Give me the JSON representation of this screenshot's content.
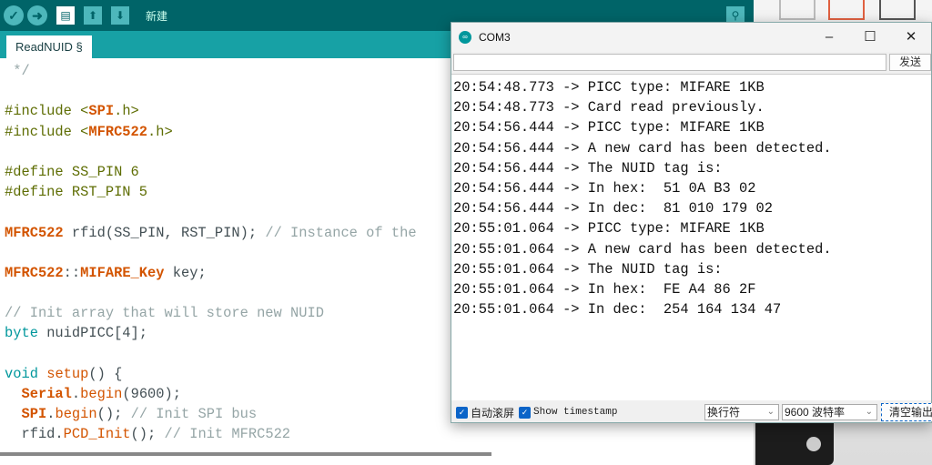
{
  "toolbar": {
    "new_label": "新建"
  },
  "editor": {
    "tab_label": "ReadNUID §",
    "lines": [
      [
        [
          " */",
          "cm"
        ]
      ],
      [],
      [
        [
          "#include <",
          "pp"
        ],
        [
          "SPI",
          "cls"
        ],
        [
          ".h>",
          "pp"
        ]
      ],
      [
        [
          "#include <",
          "pp"
        ],
        [
          "MFRC522",
          "cls"
        ],
        [
          ".h>",
          "pp"
        ]
      ],
      [],
      [
        [
          "#define SS_PIN 6",
          "pp"
        ]
      ],
      [
        [
          "#define RST_PIN 5",
          "pp"
        ]
      ],
      [],
      [
        [
          "MFRC522",
          "cls"
        ],
        [
          " rfid(SS_PIN, RST_PIN); ",
          ""
        ],
        [
          "// Instance of the",
          "cm"
        ]
      ],
      [],
      [
        [
          "MFRC522",
          "cls"
        ],
        [
          "::",
          ""
        ],
        [
          "MIFARE_Key",
          "cls"
        ],
        [
          " key;",
          ""
        ]
      ],
      [],
      [
        [
          "// Init array that will store new NUID",
          "cm"
        ]
      ],
      [
        [
          "byte",
          "kw"
        ],
        [
          " nuidPICC[4];",
          ""
        ]
      ],
      [],
      [
        [
          "void",
          "kw"
        ],
        [
          " ",
          ""
        ],
        [
          "setup",
          "fn"
        ],
        [
          "() {",
          ""
        ]
      ],
      [
        [
          "  ",
          ""
        ],
        [
          "Serial",
          "cls"
        ],
        [
          ".",
          ""
        ],
        [
          "begin",
          "fn"
        ],
        [
          "(9600);",
          ""
        ]
      ],
      [
        [
          "  ",
          ""
        ],
        [
          "SPI",
          "cls"
        ],
        [
          ".",
          ""
        ],
        [
          "begin",
          "fn"
        ],
        [
          "(); ",
          ""
        ],
        [
          "// Init SPI bus",
          "cm"
        ]
      ],
      [
        [
          "  rfid.",
          ""
        ],
        [
          "PCD_Init",
          "fn"
        ],
        [
          "(); ",
          ""
        ],
        [
          "// Init MFRC522",
          "cm"
        ]
      ]
    ]
  },
  "serial": {
    "title": "COM3",
    "send_label": "发送",
    "send_value": "",
    "output": [
      "20:54:48.773 -> PICC type: MIFARE 1KB",
      "20:54:48.773 -> Card read previously.",
      "20:54:56.444 -> PICC type: MIFARE 1KB",
      "20:54:56.444 -> A new card has been detected.",
      "20:54:56.444 -> The NUID tag is:",
      "20:54:56.444 -> In hex:  51 0A B3 02",
      "20:54:56.444 -> In dec:  81 010 179 02",
      "20:55:01.064 -> PICC type: MIFARE 1KB",
      "20:55:01.064 -> A new card has been detected.",
      "20:55:01.064 -> The NUID tag is:",
      "20:55:01.064 -> In hex:  FE A4 86 2F",
      "20:55:01.064 -> In dec:  254 164 134 47"
    ],
    "autoscroll_label": "自动滚屏",
    "autoscroll_checked": true,
    "timestamp_label": "Show timestamp",
    "timestamp_checked": true,
    "line_ending": "换行符",
    "baud": "9600 波特率",
    "clear_label": "清空输出"
  },
  "colors": {
    "toolbar": "#006468",
    "tabbar": "#17a1a5",
    "keyword_orange": "#d35400"
  }
}
